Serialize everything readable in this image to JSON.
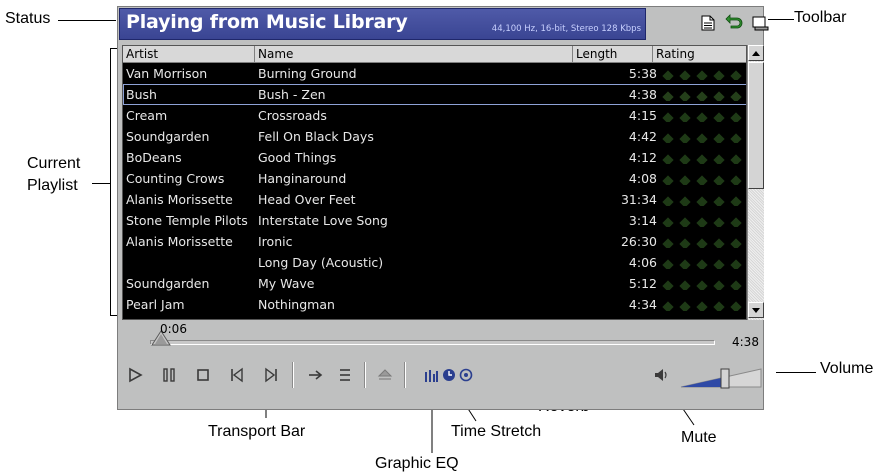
{
  "annotations": {
    "status": "Status",
    "toolbar": "Toolbar",
    "current_playlist_line1": "Current",
    "current_playlist_line2": "Playlist",
    "volume": "Volume",
    "reverb": "Reverb",
    "time_stretch": "Time Stretch",
    "mute": "Mute",
    "transport_bar": "Transport Bar",
    "graphic_eq": "Graphic EQ"
  },
  "status": {
    "title": "Playing from Music Library",
    "format": "44,100 Hz, 16-bit, Stereo  128 Kbps"
  },
  "toolbar": {
    "buttons": [
      "document-icon",
      "back-arrow-icon",
      "window-icon"
    ]
  },
  "playlist": {
    "columns": [
      "Artist",
      "Name",
      "Length",
      "Rating"
    ],
    "selected_index": 1,
    "rows": [
      {
        "artist": "Van Morrison",
        "name": "Burning Ground",
        "length": "5:38"
      },
      {
        "artist": "Bush",
        "name": "Bush - Zen",
        "length": "4:38"
      },
      {
        "artist": "Cream",
        "name": "Crossroads",
        "length": "4:15"
      },
      {
        "artist": "Soundgarden",
        "name": "Fell On Black Days",
        "length": "4:42"
      },
      {
        "artist": "BoDeans",
        "name": "Good Things",
        "length": "4:12"
      },
      {
        "artist": "Counting Crows",
        "name": "Hanginaround",
        "length": "4:08"
      },
      {
        "artist": "Alanis Morissette",
        "name": "Head Over Feet",
        "length": "31:34"
      },
      {
        "artist": "Stone Temple Pilots",
        "name": "Interstate Love Song",
        "length": "3:14"
      },
      {
        "artist": "Alanis Morissette",
        "name": "Ironic",
        "length": "26:30"
      },
      {
        "artist": "",
        "name": "Long Day (Acoustic)",
        "length": "4:06"
      },
      {
        "artist": "Soundgarden",
        "name": "My Wave",
        "length": "5:12"
      },
      {
        "artist": "Pearl Jam",
        "name": "Nothingman",
        "length": "4:34"
      }
    ]
  },
  "seek": {
    "current": "0:06",
    "total": "4:38",
    "position_fraction": 0.02
  },
  "volume": {
    "level_fraction": 0.55
  },
  "colors": {
    "status_bg": "#3f4a98",
    "playlist_bg": "#000000",
    "selection_outline": "#8ea2d6",
    "rating_diamond": "#1e3a16"
  }
}
